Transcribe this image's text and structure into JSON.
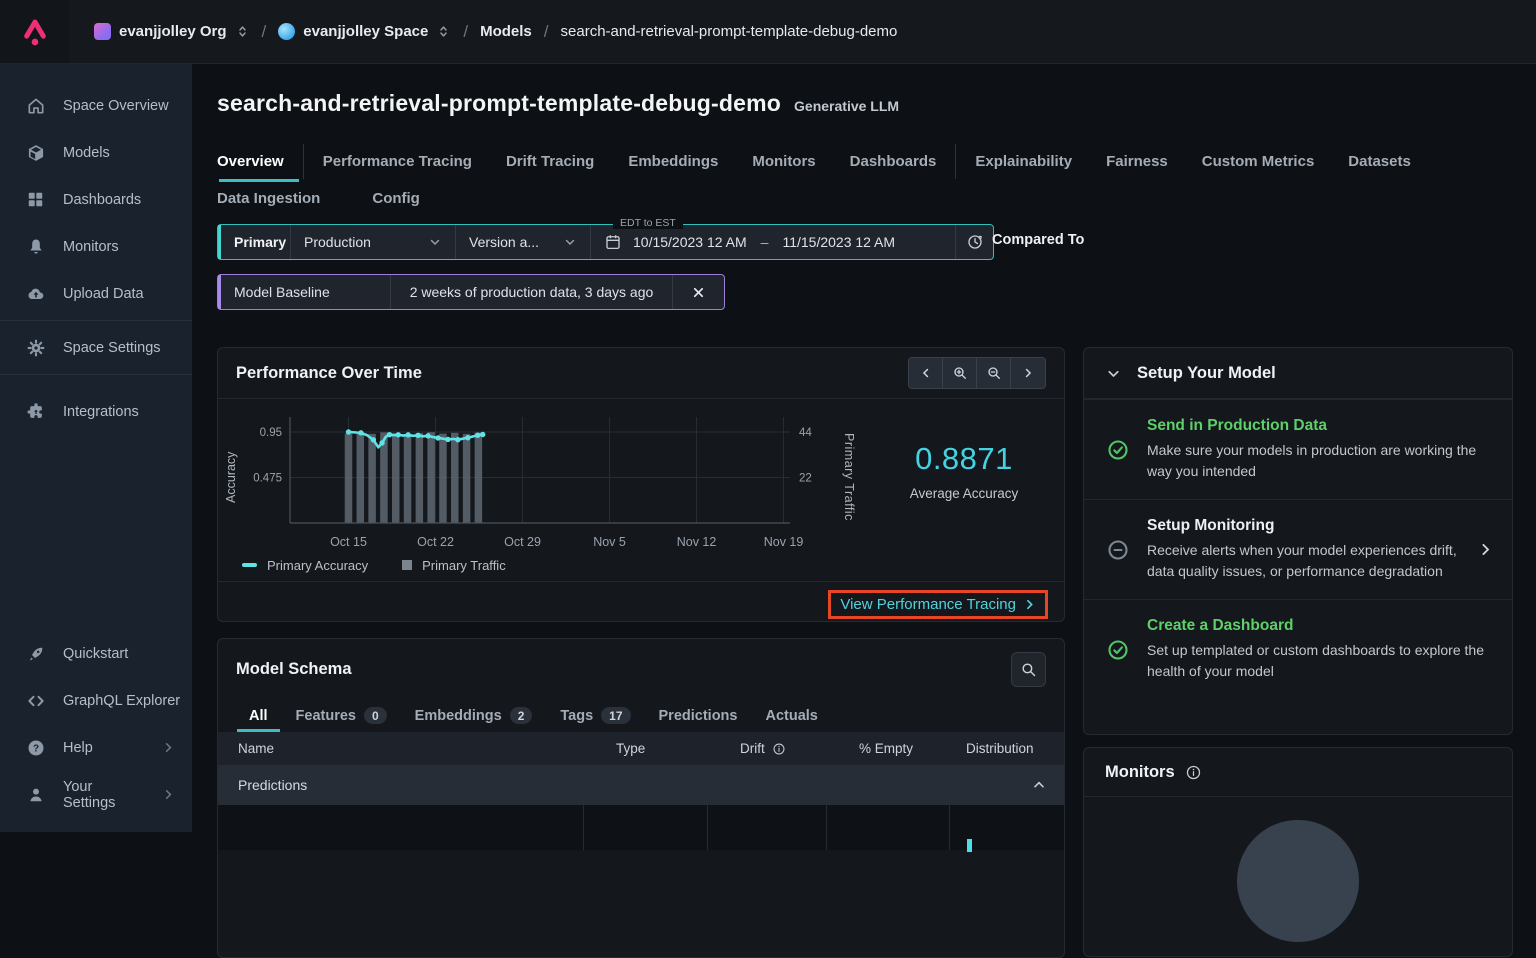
{
  "topbar": {
    "org_label": "evanjjolley Org",
    "space_label": "evanjjolley Space",
    "crumb_models": "Models",
    "crumb_model": "search-and-retrieval-prompt-template-debug-demo"
  },
  "sidebar": {
    "items": [
      {
        "label": "Space Overview"
      },
      {
        "label": "Models"
      },
      {
        "label": "Dashboards"
      },
      {
        "label": "Monitors"
      },
      {
        "label": "Upload Data"
      },
      {
        "label": "Space Settings"
      },
      {
        "label": "Integrations"
      }
    ],
    "bottom": [
      {
        "label": "Quickstart"
      },
      {
        "label": "GraphQL Explorer"
      },
      {
        "label": "Help"
      },
      {
        "label": "Your Settings"
      }
    ]
  },
  "header": {
    "title": "search-and-retrieval-prompt-template-debug-demo",
    "model_type": "Generative LLM"
  },
  "tabs": {
    "row1": [
      "Overview",
      "Performance Tracing",
      "Drift Tracing",
      "Embeddings",
      "Monitors",
      "Dashboards",
      "Explainability",
      "Fairness",
      "Custom Metrics",
      "Datasets"
    ],
    "row2": [
      "Data Ingestion",
      "Config"
    ],
    "active": "Overview"
  },
  "filters": {
    "primary_label": "Primary",
    "environment": "Production",
    "version": "Version a...",
    "timezone_note": "EDT to EST",
    "date_start": "10/15/2023 12 AM",
    "date_separator": "–",
    "date_end": "11/15/2023 12 AM",
    "compared_to": "Compared To",
    "baseline_label": "Model Baseline",
    "baseline_value": "2 weeks of production data, 3 days ago"
  },
  "performance": {
    "title": "Performance Over Time",
    "avg_value": "0.8871",
    "avg_label": "Average Accuracy",
    "legend_accuracy": "Primary Accuracy",
    "legend_traffic": "Primary Traffic",
    "link_label": "View Performance Tracing"
  },
  "chart_data": {
    "type": "line+bar",
    "title": "Performance Over Time",
    "x_tick_labels": [
      "Oct 15",
      "Oct 22",
      "Oct 29",
      "Nov 5",
      "Nov 12",
      "Nov 19"
    ],
    "x_tick_days": [
      0,
      7,
      14,
      21,
      28,
      35
    ],
    "left_axis": {
      "label": "Accuracy",
      "ticks": [
        0.95,
        0.475
      ],
      "min": 0
    },
    "right_axis": {
      "label": "Primary Traffic",
      "ticks": [
        44,
        22
      ],
      "min": 0
    },
    "grid": true,
    "legend_position": "bottom-left",
    "series": [
      {
        "name": "Primary Accuracy",
        "type": "line",
        "color": "#5ce4e6",
        "points": [
          [
            0,
            0.95
          ],
          [
            0.5,
            0.946
          ],
          [
            1,
            0.941
          ],
          [
            1.5,
            0.916
          ],
          [
            2,
            0.868
          ],
          [
            2.4,
            0.79
          ],
          [
            2.7,
            0.836
          ],
          [
            3,
            0.9
          ],
          [
            3.3,
            0.922
          ],
          [
            3.7,
            0.917
          ],
          [
            4,
            0.921
          ],
          [
            4.4,
            0.913
          ],
          [
            4.8,
            0.92
          ],
          [
            5.2,
            0.91
          ],
          [
            5.6,
            0.915
          ],
          [
            6,
            0.905
          ],
          [
            6.4,
            0.91
          ],
          [
            6.8,
            0.897
          ],
          [
            7.2,
            0.888
          ],
          [
            7.6,
            0.88
          ],
          [
            8,
            0.872
          ],
          [
            8.4,
            0.878
          ],
          [
            8.8,
            0.87
          ],
          [
            9.2,
            0.88
          ],
          [
            9.6,
            0.89
          ],
          [
            10,
            0.903
          ],
          [
            10.4,
            0.916
          ],
          [
            10.8,
            0.924
          ]
        ]
      },
      {
        "name": "Primary Traffic",
        "type": "bar",
        "color": "#626b75",
        "points": [
          [
            0,
            43.2
          ],
          [
            0.95,
            43.6
          ],
          [
            1.9,
            43.1
          ],
          [
            2.85,
            43.8
          ],
          [
            3.8,
            43.4
          ],
          [
            4.75,
            43.0
          ],
          [
            5.7,
            43.5
          ],
          [
            6.65,
            43.9
          ],
          [
            7.6,
            43.2
          ],
          [
            8.55,
            43.6
          ],
          [
            9.5,
            43.1
          ],
          [
            10.45,
            43.7
          ]
        ]
      }
    ],
    "summary": {
      "value": "0.8871",
      "label": "Average Accuracy"
    }
  },
  "schema": {
    "title": "Model Schema",
    "tabs": [
      {
        "label": "All",
        "count": ""
      },
      {
        "label": "Features",
        "count": "0"
      },
      {
        "label": "Embeddings",
        "count": "2"
      },
      {
        "label": "Tags",
        "count": "17"
      },
      {
        "label": "Predictions",
        "count": ""
      },
      {
        "label": "Actuals",
        "count": ""
      }
    ],
    "columns": {
      "name": "Name",
      "type": "Type",
      "drift": "Drift",
      "empty": "% Empty",
      "distribution": "Distribution"
    },
    "group_row": "Predictions"
  },
  "setup": {
    "title": "Setup Your Model",
    "items": [
      {
        "title": "Send in Production Data",
        "desc": "Make sure your models in production are working the way you intended",
        "status": "done"
      },
      {
        "title": "Setup Monitoring",
        "desc": "Receive alerts when your model experiences drift, data quality issues, or performance degradation",
        "status": "pending"
      },
      {
        "title": "Create a Dashboard",
        "desc": "Set up templated or custom dashboards to explore the health of your model",
        "status": "done"
      }
    ]
  },
  "monitors": {
    "title": "Monitors"
  },
  "colors": {
    "accent_teal": "#3fbdc2",
    "accent_cyan_line": "#5ce4e6",
    "accent_green": "#5ecf69",
    "accent_purple": "#9b7fd9",
    "annotation_red": "#e64526",
    "brand_pink": "#ed2f73",
    "bar_gray": "#626b75"
  }
}
